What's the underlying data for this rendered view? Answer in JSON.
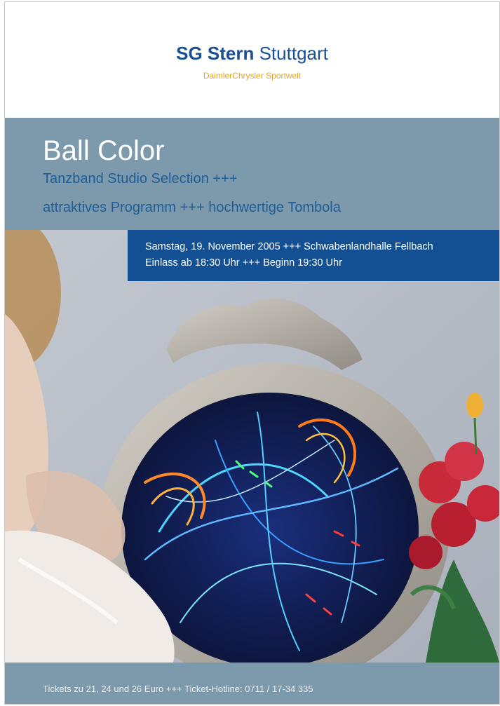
{
  "header": {
    "brand_bold": "SG Stern",
    "brand_regular": "Stuttgart",
    "sub": "DaimlerChrysler Sportwelt"
  },
  "event": {
    "title": "Ball Color",
    "line1": "Tanzband Studio Selection +++",
    "line2": "attraktives Programm +++ hochwertige Tombola"
  },
  "details": {
    "line1": "Samstag, 19. November 2005 +++ Schwabenlandhalle Fellbach",
    "line2": "Einlass ab 18:30 Uhr +++ Beginn 19:30 Uhr"
  },
  "footer": {
    "text": "Tickets zu 21, 24 und 26 Euro +++ Ticket-Hotline: 0711 / 17-34 335"
  },
  "colors": {
    "brand_blue": "#1b4f93",
    "brand_orange": "#e3a527",
    "band": "#7d9aad",
    "date_box": "#134f93"
  }
}
